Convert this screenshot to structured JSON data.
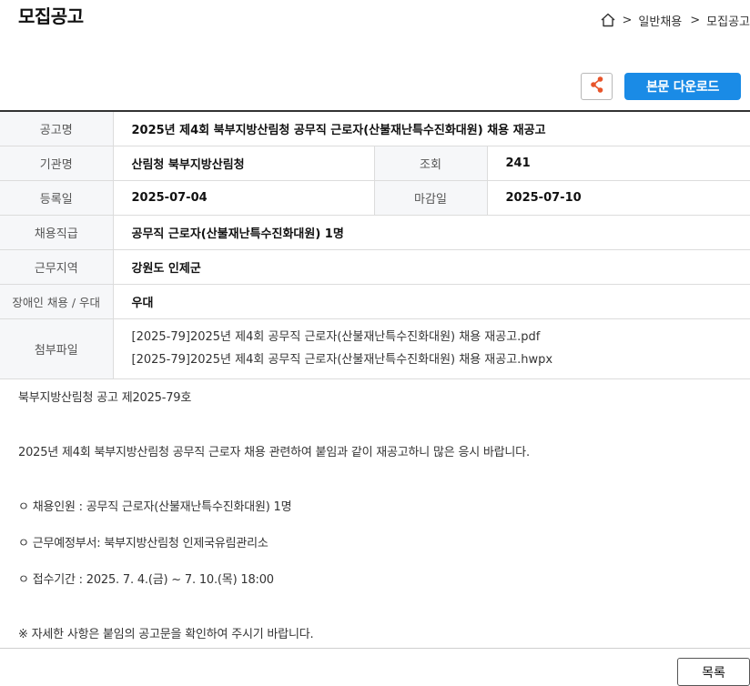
{
  "page_title": "모집공고",
  "breadcrumb": {
    "items": [
      "일반채용",
      "모집공고"
    ],
    "separator": ">"
  },
  "actions": {
    "download_label": "본문 다운로드"
  },
  "details": {
    "title_label": "공고명",
    "title_value": "2025년 제4회 북부지방산림청 공무직 근로자(산불재난특수진화대원) 채용 재공고",
    "agency_label": "기관명",
    "agency_value": "산림청 북부지방산림청",
    "views_label": "조회",
    "views_value": "241",
    "registered_label": "등록일",
    "registered_value": "2025-07-04",
    "deadline_label": "마감일",
    "deadline_value": "2025-07-10",
    "grade_label": "채용직급",
    "grade_value": "공무직 근로자(산불재난특수진화대원) 1명",
    "region_label": "근무지역",
    "region_value": "강원도 인제군",
    "disability_label": "장애인 채용 / 우대",
    "disability_value": "우대",
    "attachments_label": "첨부파일",
    "attachments": [
      "[2025-79]2025년 제4회 공무직 근로자(산불재난특수진화대원) 채용 재공고.pdf",
      "[2025-79]2025년 제4회 공무직 근로자(산불재난특수진화대원) 채용 재공고.hwpx"
    ]
  },
  "body": {
    "lines": [
      "북부지방산림청 공고 제2025-79호",
      "2025년 제4회 북부지방산림청 공무직 근로자 채용 관련하여 붙임과 같이 재공고하니 많은 응시 바랍니다.",
      "ㅇ 채용인원 : 공무직 근로자(산불재난특수진화대원) 1명",
      "ㅇ 근무예정부서: 북부지방산림청 인제국유림관리소",
      "ㅇ 접수기간 : 2025. 7. 4.(금) ~ 7. 10.(목) 18:00",
      "※ 자세한 사항은 붙임의 공고문을 확인하여 주시기 바랍니다."
    ]
  },
  "footer": {
    "list_label": "목록"
  },
  "colors": {
    "accent": "#1a8be6",
    "share_icon": "#e8542a",
    "header_cell_bg": "#f6f7f9"
  }
}
